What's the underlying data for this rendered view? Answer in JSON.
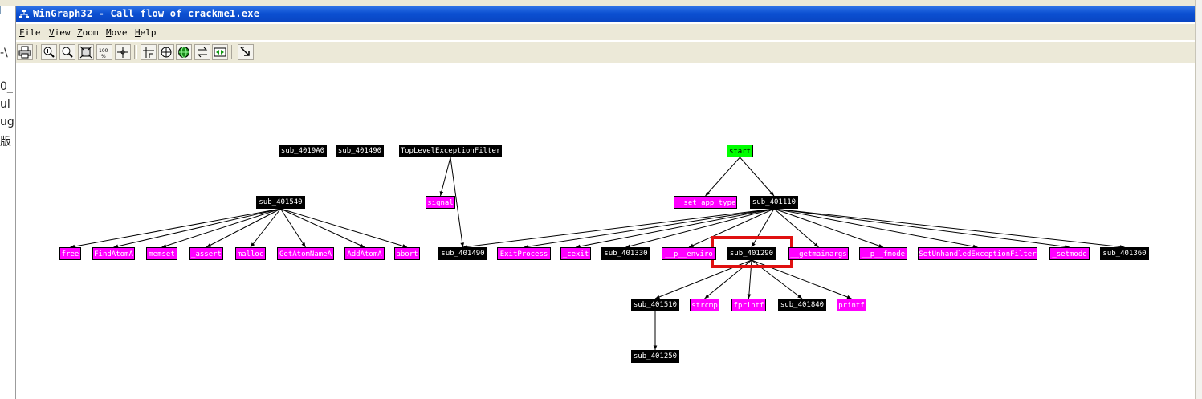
{
  "window": {
    "title": "WinGraph32 - Call flow of crackme1.exe",
    "title_icon": "graph-tree-icon"
  },
  "menu": [
    "File",
    "View",
    "Zoom",
    "Move",
    "Help"
  ],
  "toolbar": {
    "buttons": [
      {
        "name": "print-button",
        "icon": "printer-icon"
      },
      {
        "name": "zoom-in-button",
        "icon": "zoom-in-icon"
      },
      {
        "name": "zoom-out-button",
        "icon": "zoom-out-icon"
      },
      {
        "name": "fit-window-button",
        "icon": "fit-icon"
      },
      {
        "name": "zoom-100-button",
        "icon": "zoom-100-icon",
        "label": "100"
      },
      {
        "name": "center-button",
        "icon": "crosshair-icon"
      },
      {
        "name": "layout-button",
        "icon": "layout-icon"
      },
      {
        "name": "radar-button",
        "icon": "radar-icon"
      },
      {
        "name": "follow-edge-button",
        "icon": "globe-icon"
      },
      {
        "name": "swap-button",
        "icon": "swap-icon"
      },
      {
        "name": "expand-button",
        "icon": "expand-icon"
      },
      {
        "name": "pointer-button",
        "icon": "pointer-icon"
      }
    ]
  },
  "background_fragments": [
    "-\\",
    "0_",
    "ul",
    "ug",
    "版"
  ],
  "graph": {
    "colors": {
      "black": "#000000",
      "magenta": "#ff00ff",
      "green": "#00ff00",
      "highlight": "#e01010"
    },
    "nodes": [
      {
        "id": "sub_4019A0",
        "label": "sub_4019A0",
        "kind": "black"
      },
      {
        "id": "sub_401490",
        "label": "sub_401490",
        "kind": "black"
      },
      {
        "id": "TopLevelExceptionFilter",
        "label": "TopLevelExceptionFilter",
        "kind": "black"
      },
      {
        "id": "start",
        "label": "start",
        "kind": "green"
      },
      {
        "id": "sub_401540",
        "label": "sub_401540",
        "kind": "black"
      },
      {
        "id": "signal",
        "label": "signal",
        "kind": "magenta"
      },
      {
        "id": "__set_app_type",
        "label": "__set_app_type",
        "kind": "magenta"
      },
      {
        "id": "sub_401110",
        "label": "sub_401110",
        "kind": "black"
      },
      {
        "id": "free",
        "label": "free",
        "kind": "magenta"
      },
      {
        "id": "FindAtomA",
        "label": "FindAtomA",
        "kind": "magenta"
      },
      {
        "id": "memset",
        "label": "memset",
        "kind": "magenta"
      },
      {
        "id": "_assert",
        "label": "_assert",
        "kind": "magenta"
      },
      {
        "id": "malloc",
        "label": "malloc",
        "kind": "magenta"
      },
      {
        "id": "GetAtomNameA",
        "label": "GetAtomNameA",
        "kind": "magenta"
      },
      {
        "id": "AddAtomA",
        "label": "AddAtomA",
        "kind": "magenta"
      },
      {
        "id": "abort",
        "label": "abort",
        "kind": "magenta"
      },
      {
        "id": "sub_401490b",
        "label": "sub_401490",
        "kind": "black"
      },
      {
        "id": "ExitProcess",
        "label": "ExitProcess",
        "kind": "magenta"
      },
      {
        "id": "_cexit",
        "label": "_cexit",
        "kind": "magenta"
      },
      {
        "id": "sub_401330",
        "label": "sub_401330",
        "kind": "black"
      },
      {
        "id": "__p__environ",
        "label": "__p__enviro",
        "kind": "magenta"
      },
      {
        "id": "sub_401290",
        "label": "sub_401290",
        "kind": "black"
      },
      {
        "id": "__getmainargs",
        "label": "__getmainargs",
        "kind": "magenta"
      },
      {
        "id": "__p__fmode",
        "label": "__p__fmode",
        "kind": "magenta"
      },
      {
        "id": "SetUnhandledExceptionFilter",
        "label": "SetUnhandledExceptionFilter",
        "kind": "magenta"
      },
      {
        "id": "_setmode",
        "label": "_setmode",
        "kind": "magenta"
      },
      {
        "id": "sub_401360",
        "label": "sub_401360",
        "kind": "black"
      },
      {
        "id": "sub_401510",
        "label": "sub_401510",
        "kind": "black"
      },
      {
        "id": "strcmp",
        "label": "strcmp",
        "kind": "magenta"
      },
      {
        "id": "fprintf",
        "label": "fprintf",
        "kind": "magenta"
      },
      {
        "id": "sub_401840",
        "label": "sub_401840",
        "kind": "black"
      },
      {
        "id": "printf",
        "label": "printf",
        "kind": "magenta"
      },
      {
        "id": "sub_401250",
        "label": "sub_401250",
        "kind": "black"
      }
    ],
    "edges": [
      [
        "TopLevelExceptionFilter",
        "signal"
      ],
      [
        "TopLevelExceptionFilter",
        "sub_401490b"
      ],
      [
        "start",
        "__set_app_type"
      ],
      [
        "start",
        "sub_401110"
      ],
      [
        "sub_401540",
        "free"
      ],
      [
        "sub_401540",
        "FindAtomA"
      ],
      [
        "sub_401540",
        "memset"
      ],
      [
        "sub_401540",
        "_assert"
      ],
      [
        "sub_401540",
        "malloc"
      ],
      [
        "sub_401540",
        "GetAtomNameA"
      ],
      [
        "sub_401540",
        "AddAtomA"
      ],
      [
        "sub_401540",
        "abort"
      ],
      [
        "sub_401110",
        "sub_401490b"
      ],
      [
        "sub_401110",
        "ExitProcess"
      ],
      [
        "sub_401110",
        "_cexit"
      ],
      [
        "sub_401110",
        "sub_401330"
      ],
      [
        "sub_401110",
        "__p__environ"
      ],
      [
        "sub_401110",
        "sub_401290"
      ],
      [
        "sub_401110",
        "__getmainargs"
      ],
      [
        "sub_401110",
        "__p__fmode"
      ],
      [
        "sub_401110",
        "SetUnhandledExceptionFilter"
      ],
      [
        "sub_401110",
        "_setmode"
      ],
      [
        "sub_401110",
        "sub_401360"
      ],
      [
        "sub_401290",
        "sub_401510"
      ],
      [
        "sub_401290",
        "strcmp"
      ],
      [
        "sub_401290",
        "fprintf"
      ],
      [
        "sub_401290",
        "sub_401840"
      ],
      [
        "sub_401290",
        "printf"
      ],
      [
        "sub_401510",
        "sub_401250"
      ]
    ],
    "highlighted_node": "sub_401290"
  }
}
